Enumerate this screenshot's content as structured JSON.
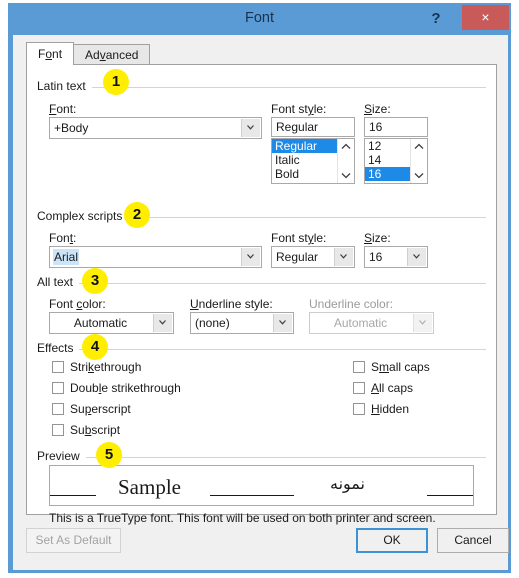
{
  "window": {
    "title": "Font",
    "help_icon": "?",
    "close_icon": "×"
  },
  "tabs": [
    {
      "label": "Font",
      "accel_index": 2,
      "active": true
    },
    {
      "label": "Advanced",
      "accel_index": 2,
      "active": false
    }
  ],
  "groups": {
    "latin": {
      "title": "Latin text",
      "badge": "1",
      "font_label": "Font:",
      "font_value": "+Body",
      "style_label": "Font style:",
      "style_value": "Regular",
      "style_options": [
        "Regular",
        "Italic",
        "Bold"
      ],
      "style_selected": "Regular",
      "size_label": "Size:",
      "size_value": "16",
      "size_options": [
        "12",
        "14",
        "16"
      ],
      "size_selected": "16"
    },
    "complex": {
      "title": "Complex scripts",
      "badge": "2",
      "font_label": "Font:",
      "font_value": "Arial",
      "style_label": "Font style:",
      "style_value": "Regular",
      "size_label": "Size:",
      "size_value": "16"
    },
    "alltext": {
      "title": "All text",
      "badge": "3",
      "font_color_label": "Font color:",
      "font_color_value": "Automatic",
      "underline_style_label": "Underline style:",
      "underline_style_value": "(none)",
      "underline_color_label": "Underline color:",
      "underline_color_value": "Automatic"
    },
    "effects": {
      "title": "Effects",
      "badge": "4",
      "left": [
        {
          "label": "Strikethrough",
          "checked": false
        },
        {
          "label": "Double strikethrough",
          "checked": false
        },
        {
          "label": "Superscript",
          "checked": false
        },
        {
          "label": "Subscript",
          "checked": false
        }
      ],
      "right": [
        {
          "label": "Small caps",
          "checked": false
        },
        {
          "label": "All caps",
          "checked": false
        },
        {
          "label": "Hidden",
          "checked": false
        }
      ]
    },
    "preview": {
      "title": "Preview",
      "badge": "5",
      "sample_text": "Sample",
      "sample_text_rtl": "نمونه",
      "note": "This is a TrueType font. This font will be used on both printer and screen."
    }
  },
  "footer": {
    "set_as_default": "Set As Default",
    "ok": "OK",
    "cancel": "Cancel"
  },
  "colors": {
    "titlebar": "#5b9bd5",
    "close": "#c85a5a",
    "selection": "#1e8ae8",
    "badge": "#ffee00",
    "default_button_border": "#3f92d2"
  }
}
